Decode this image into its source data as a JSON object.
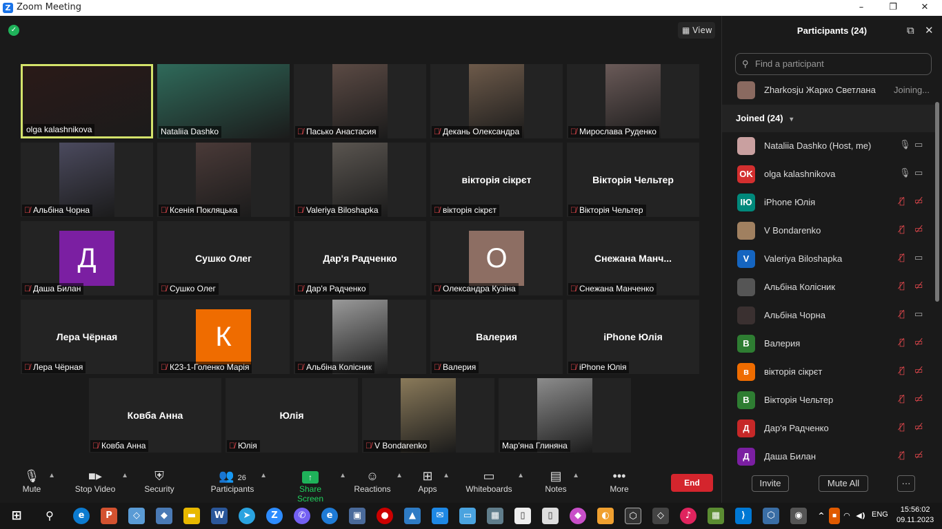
{
  "window": {
    "title": "Zoom Meeting",
    "minimize": "–",
    "maximize": "❐",
    "close": "✕"
  },
  "view_label": "View",
  "tiles": [
    {
      "name": "olga kalashnikova",
      "muted": false,
      "video": true,
      "bg": "#2a1a18"
    },
    {
      "name": "Nataliia Dashko",
      "muted": false,
      "video": true,
      "bg": "#2f6a5a"
    },
    {
      "name": "Пасько Анастасия",
      "muted": true,
      "video": true,
      "bg": "#5b4a44"
    },
    {
      "name": "Декань Олександра",
      "muted": true,
      "video": true,
      "bg": "#6d5a4a"
    },
    {
      "name": "Мирослава Руденко",
      "muted": true,
      "video": true,
      "bg": "#6a5a58"
    },
    {
      "name": "Альбіна Чорна",
      "muted": true,
      "video": true,
      "bg": "#4b4a5e"
    },
    {
      "name": "Ксенія Покляцька",
      "muted": true,
      "video": true,
      "bg": "#4a3a38"
    },
    {
      "name": "Valeriya Biloshapka",
      "muted": true,
      "video": true,
      "bg": "#5a5550"
    },
    {
      "name": "вікторія сікрєт",
      "center": "вікторія сікрєт",
      "muted": true,
      "video": false
    },
    {
      "name": "Вікторія Чельтер",
      "center": "Вікторія Чельтер",
      "muted": true,
      "video": false
    },
    {
      "name": "Даша Билан",
      "avatar": "Д",
      "avatar_color": "#7b1fa2",
      "muted": true,
      "video": false
    },
    {
      "name": "Сушко Олег",
      "center": "Сушко Олег",
      "muted": true,
      "video": false
    },
    {
      "name": "Дар'я Радченко",
      "center": "Дар'я Радченко",
      "muted": true,
      "video": false
    },
    {
      "name": "Олександра Кузіна",
      "avatar": "О",
      "avatar_color": "#8d6e63",
      "muted": true,
      "video": false
    },
    {
      "name": "Снежана Манченко",
      "center": "Снежана  Манч...",
      "muted": true,
      "video": false
    },
    {
      "name": "Лера Чёрная",
      "center": "Лера Чёрная",
      "muted": true,
      "video": false
    },
    {
      "name": "К23-1-Голенко Марія",
      "avatar": "К",
      "avatar_color": "#ef6c00",
      "muted": true,
      "video": false
    },
    {
      "name": "Альбіна Колісник",
      "muted": true,
      "video": true,
      "bg": "#9a9a9a"
    },
    {
      "name": "Валерия",
      "center": "Валерия",
      "muted": true,
      "video": false
    },
    {
      "name": "iPhone Юлія",
      "center": "iPhone Юлія",
      "muted": true,
      "video": false
    },
    {
      "name": "Ковба Анна",
      "center": "Ковба Анна",
      "muted": true,
      "video": false
    },
    {
      "name": "Юлія",
      "center": "Юлія",
      "muted": true,
      "video": false
    },
    {
      "name": "V Bondarenko",
      "muted": true,
      "video": true,
      "bg": "#8a7a5a"
    },
    {
      "name": "Мар'яна Глиняна",
      "muted": false,
      "video": true,
      "bg": "#8c8c8c"
    }
  ],
  "toolbar": {
    "mute": "Mute",
    "stop_video": "Stop Video",
    "security": "Security",
    "participants": "Participants",
    "participants_count": "26",
    "share_screen": "Share Screen",
    "reactions": "Reactions",
    "apps": "Apps",
    "whiteboards": "Whiteboards",
    "notes": "Notes",
    "more": "More",
    "end": "End"
  },
  "panel": {
    "title": "Participants (24)",
    "search_placeholder": "Find a participant",
    "joining": {
      "name": "Zharkosju Жарко Светлана",
      "status": "Joining..."
    },
    "joined_header": "Joined (24)",
    "participants": [
      {
        "name": "Nataliia Dashko (Host, me)",
        "initials": "",
        "color": "#c9a0a0",
        "mic": "on",
        "cam": "on"
      },
      {
        "name": "olga kalashnikova",
        "initials": "OK",
        "color": "#d32f2f",
        "mic": "on",
        "cam": "on"
      },
      {
        "name": "iPhone Юлія",
        "initials": "ІЮ",
        "color": "#00897b",
        "mic": "off",
        "cam": "off"
      },
      {
        "name": "V Bondarenko",
        "initials": "",
        "color": "#a08060",
        "mic": "off",
        "cam": "off"
      },
      {
        "name": "Valeriya Biloshapka",
        "initials": "V",
        "color": "#1565c0",
        "mic": "off",
        "cam": "on"
      },
      {
        "name": "Альбіна Колісник",
        "initials": "",
        "color": "#555555",
        "mic": "off",
        "cam": "off"
      },
      {
        "name": "Альбіна Чорна",
        "initials": "",
        "color": "#3a3030",
        "mic": "off",
        "cam": "on"
      },
      {
        "name": "Валерия",
        "initials": "В",
        "color": "#2e7d32",
        "mic": "off",
        "cam": "off"
      },
      {
        "name": "вікторія сікрєт",
        "initials": "в",
        "color": "#ef6c00",
        "mic": "off",
        "cam": "off"
      },
      {
        "name": "Вікторія Чельтер",
        "initials": "В",
        "color": "#2e7d32",
        "mic": "off",
        "cam": "off"
      },
      {
        "name": "Дар'я Радченко",
        "initials": "Д",
        "color": "#c62828",
        "mic": "off",
        "cam": "off"
      },
      {
        "name": "Даша Билан",
        "initials": "Д",
        "color": "#7b1fa2",
        "mic": "off",
        "cam": "off"
      }
    ],
    "invite": "Invite",
    "mute_all": "Mute All",
    "more": "···"
  },
  "taskbar": {
    "time": "15:56:02",
    "date": "09.11.2023",
    "lang": "ENG"
  }
}
